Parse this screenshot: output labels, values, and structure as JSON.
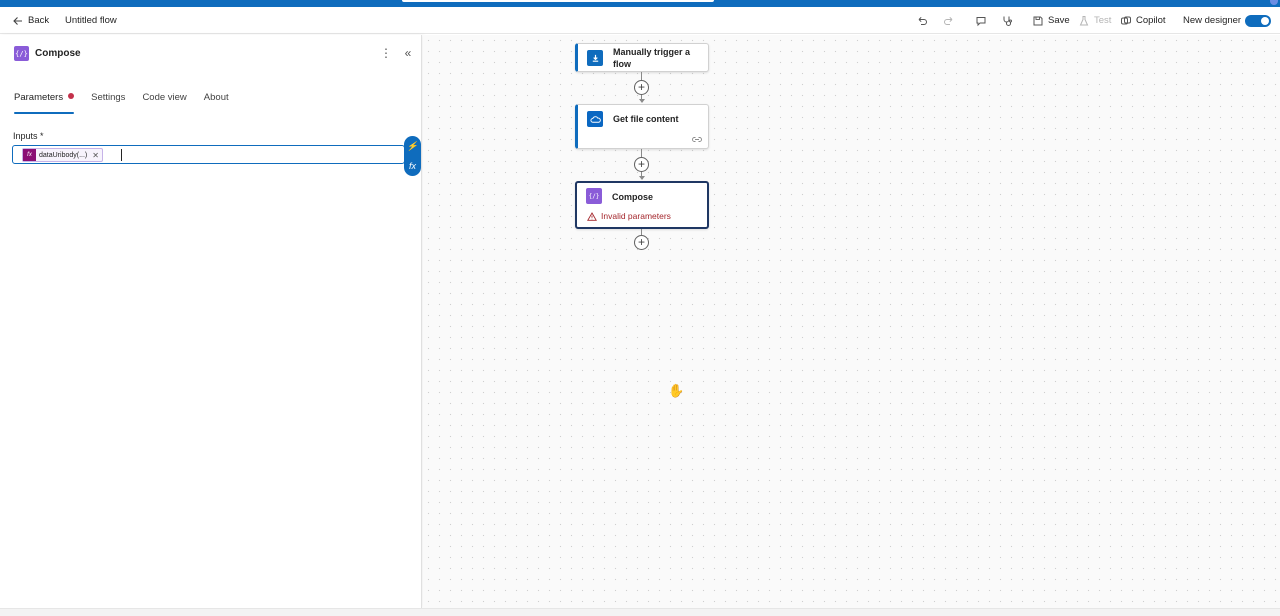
{
  "topbar": {
    "back_label": "Back",
    "flow_title": "Untitled flow",
    "save_label": "Save",
    "test_label": "Test",
    "copilot_label": "Copilot",
    "new_designer_label": "New designer",
    "new_designer_on": true
  },
  "panel": {
    "title": "Compose",
    "icon": "compose-icon",
    "tabs": [
      {
        "label": "Parameters",
        "active": true,
        "has_error": true
      },
      {
        "label": "Settings"
      },
      {
        "label": "Code view"
      },
      {
        "label": "About"
      }
    ],
    "inputs_label": "Inputs *",
    "token_text": "dataUribody(...)"
  },
  "flow": {
    "nodes": [
      {
        "title": "Manually trigger a flow",
        "icon": "manual-trigger-icon"
      },
      {
        "title": "Get file content",
        "icon": "onedrive-icon"
      },
      {
        "title": "Compose",
        "icon": "compose-icon",
        "warning": "Invalid parameters",
        "selected": true
      }
    ]
  },
  "colors": {
    "accent": "#0f6cbd",
    "compose": "#8a5cd8",
    "expression_token": "#8a0f74",
    "error": "#c4314b"
  }
}
